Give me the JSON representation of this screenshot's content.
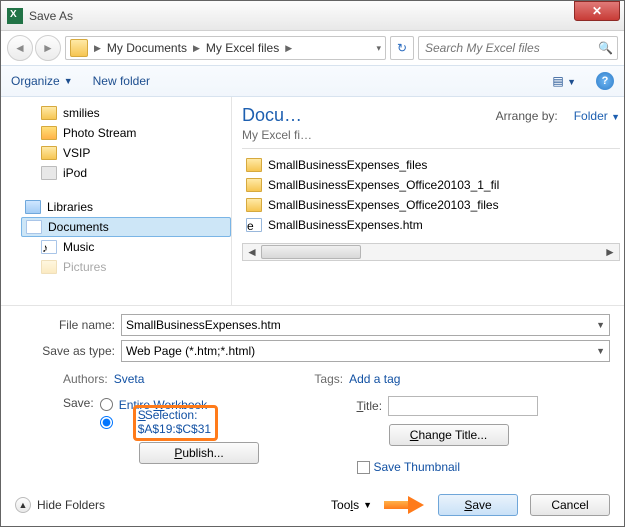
{
  "window": {
    "title": "Save As"
  },
  "nav": {
    "crumb1": "My Documents",
    "crumb2": "My Excel files",
    "search_placeholder": "Search My Excel files"
  },
  "toolbar": {
    "organize": "Organize",
    "newfolder": "New folder"
  },
  "left": {
    "items": [
      "smilies",
      "Photo Stream",
      "VSIP",
      "iPod"
    ],
    "libraries": "Libraries",
    "libs": [
      "Documents",
      "Music",
      "Pictures"
    ]
  },
  "right": {
    "title": "Docu…",
    "arrange": "Arrange by:",
    "arrange_val": "Folder",
    "subtitle": "My Excel fi…",
    "files": [
      "SmallBusinessExpenses_files",
      "SmallBusinessExpenses_Office20103_1_fil",
      "SmallBusinessExpenses_Office20103_files",
      "SmallBusinessExpenses.htm"
    ]
  },
  "form": {
    "filename_lbl": "File name:",
    "filename_val": "SmallBusinessExpenses.htm",
    "savetype_lbl": "Save as type:",
    "savetype_val": "Web Page (*.htm;*.html)",
    "authors_lbl": "Authors:",
    "authors_val": "Sveta",
    "tags_lbl": "Tags:",
    "tags_val": "Add a tag",
    "save_lbl": "Save:",
    "opt_workbook": "Entire Workbook",
    "opt_sel_a": "Selection:",
    "opt_sel_b": "$A$19:$C$31",
    "publish": "Publish...",
    "title_lbl": "Title:",
    "change_title": "Change Title...",
    "save_thumb": "Save Thumbnail"
  },
  "footer": {
    "hide": "Hide Folders",
    "tools": "Tools",
    "save": "Save",
    "cancel": "Cancel"
  }
}
